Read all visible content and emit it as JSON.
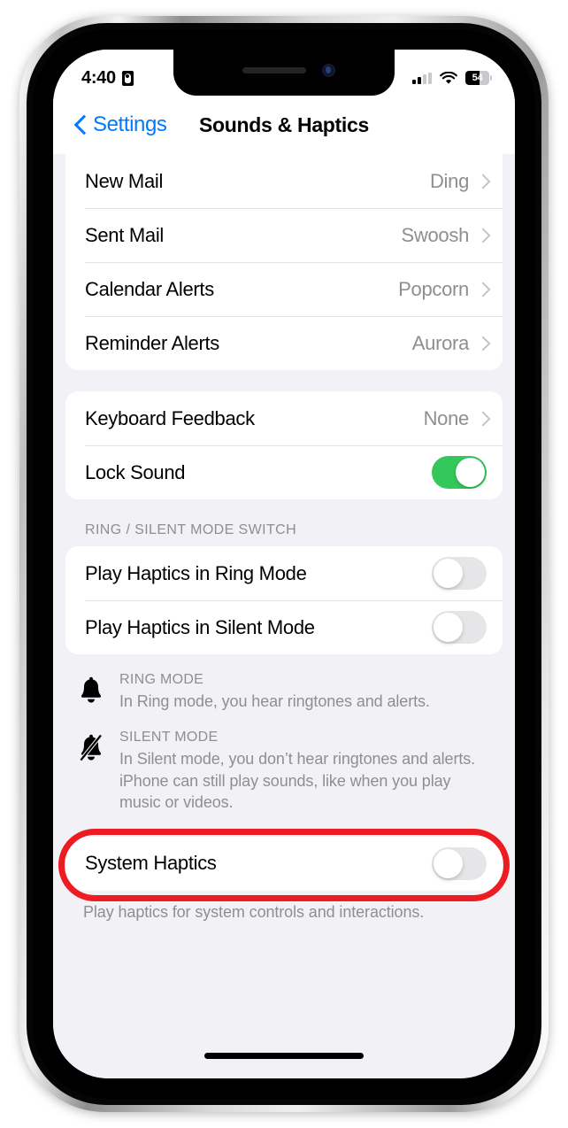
{
  "status_bar": {
    "time": "4:40",
    "lock_icon": "portrait-lock-icon",
    "signal_icon": "cellular-signal-icon",
    "wifi_icon": "wifi-icon",
    "battery_level": "54",
    "battery_icon": "battery-icon"
  },
  "nav": {
    "back_label": "Settings",
    "back_icon": "chevron-left-icon",
    "title": "Sounds & Haptics"
  },
  "groups": {
    "alert_sounds": [
      {
        "label": "New Mail",
        "value": "Ding",
        "accessory": "chevron-right-icon"
      },
      {
        "label": "Sent Mail",
        "value": "Swoosh",
        "accessory": "chevron-right-icon"
      },
      {
        "label": "Calendar Alerts",
        "value": "Popcorn",
        "accessory": "chevron-right-icon"
      },
      {
        "label": "Reminder Alerts",
        "value": "Aurora",
        "accessory": "chevron-right-icon"
      }
    ],
    "feedback": [
      {
        "label": "Keyboard Feedback",
        "value": "None",
        "accessory": "chevron-right-icon"
      },
      {
        "label": "Lock Sound",
        "toggle": "on"
      }
    ],
    "ring_silent_header": "RING / SILENT MODE SWITCH",
    "ring_silent": [
      {
        "label": "Play Haptics in Ring Mode",
        "toggle": "off"
      },
      {
        "label": "Play Haptics in Silent Mode",
        "toggle": "off"
      }
    ]
  },
  "footnotes": [
    {
      "icon": "bell-icon",
      "title": "RING MODE",
      "body": "In Ring mode, you hear ringtones and alerts."
    },
    {
      "icon": "bell-slash-icon",
      "title": "SILENT MODE",
      "body": "In Silent mode, you don’t hear ringtones and alerts. iPhone can still play sounds, like when you play music or videos."
    }
  ],
  "system_haptics": {
    "label": "System Haptics",
    "toggle": "off",
    "caption": "Play haptics for system controls and interactions.",
    "highlight_color": "#ec1c22"
  },
  "colors": {
    "accent_blue": "#007aff",
    "toggle_on_green": "#34c759",
    "toggle_off_gray": "#e6e6e8",
    "secondary_text": "#8e8e93",
    "background": "#f1f1f6"
  },
  "home_indicator": "home-indicator"
}
